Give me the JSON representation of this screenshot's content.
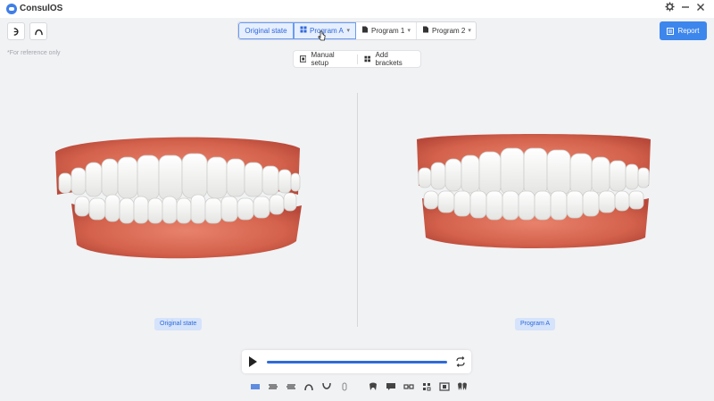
{
  "app": {
    "title": "ConsulOS"
  },
  "toolbar": {
    "tabs": [
      {
        "label": "Original state"
      },
      {
        "label": "Program A"
      },
      {
        "label": "Program 1"
      },
      {
        "label": "Program 2"
      }
    ],
    "report_label": "Report"
  },
  "reference_note": "*For reference only",
  "setup_bar": {
    "manual_setup_label": "Manual setup",
    "add_brackets_label": "Add brackets"
  },
  "viewports": {
    "left_label": "Original state",
    "right_label": "Program A"
  },
  "player": {
    "progress": 1.0
  },
  "colors": {
    "accent": "#3d86ec",
    "active_tab_bg": "#e6efff",
    "background": "#f1f2f4",
    "gum": "#d9614c",
    "tooth": "#f7f7f5"
  },
  "icons": {
    "window": [
      "gear-icon",
      "minimize-icon",
      "close-icon"
    ],
    "toolbar_left": [
      "upper-jaw-icon",
      "arch-icon"
    ],
    "view_bar": [
      "front-view-icon",
      "left-view-icon",
      "right-view-icon",
      "upper-arch-icon",
      "lower-arch-icon",
      "side-profile-icon",
      "tooth-icon",
      "comment-icon",
      "brackets-icon",
      "grid-icon",
      "bite-icon",
      "double-tooth-icon"
    ]
  }
}
